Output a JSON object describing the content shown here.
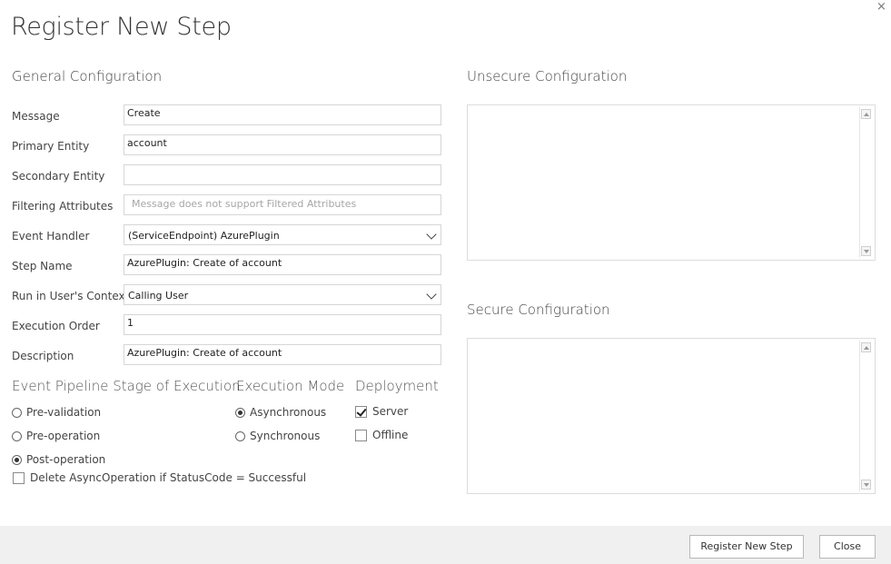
{
  "dialog": {
    "title": "Register New Step",
    "close_glyph": "×"
  },
  "general": {
    "title": "General Configuration",
    "fields": {
      "message": {
        "label": "Message",
        "value": "Create"
      },
      "primary_entity": {
        "label": "Primary Entity",
        "value": "account"
      },
      "secondary_entity": {
        "label": "Secondary Entity",
        "value": ""
      },
      "filtering_attributes": {
        "label": "Filtering Attributes",
        "placeholder": "Message does not support Filtered Attributes"
      },
      "event_handler": {
        "label": "Event Handler",
        "value": "(ServiceEndpoint) AzurePlugin"
      },
      "step_name": {
        "label": "Step Name",
        "value": "AzurePlugin: Create of account"
      },
      "run_context": {
        "label": "Run in User's Context",
        "value": "Calling User"
      },
      "execution_order": {
        "label": "Execution Order",
        "value": "1"
      },
      "description": {
        "label": "Description",
        "value": "AzurePlugin: Create of account"
      }
    }
  },
  "stage": {
    "title": "Event Pipeline Stage of Execution",
    "options": [
      "Pre-validation",
      "Pre-operation",
      "Post-operation"
    ],
    "selected": "Post-operation"
  },
  "delete_async": {
    "label": "Delete AsyncOperation if StatusCode = Successful",
    "checked": false
  },
  "mode": {
    "title": "Execution Mode",
    "options": [
      "Asynchronous",
      "Synchronous"
    ],
    "selected": "Asynchronous"
  },
  "deployment": {
    "title": "Deployment",
    "server": {
      "label": "Server",
      "checked": true
    },
    "offline": {
      "label": "Offline",
      "checked": false
    }
  },
  "unsecure": {
    "title": "Unsecure  Configuration",
    "value": ""
  },
  "secure": {
    "title": "Secure  Configuration",
    "value": ""
  },
  "footer": {
    "register_label": "Register New Step",
    "close_label": "Close"
  }
}
